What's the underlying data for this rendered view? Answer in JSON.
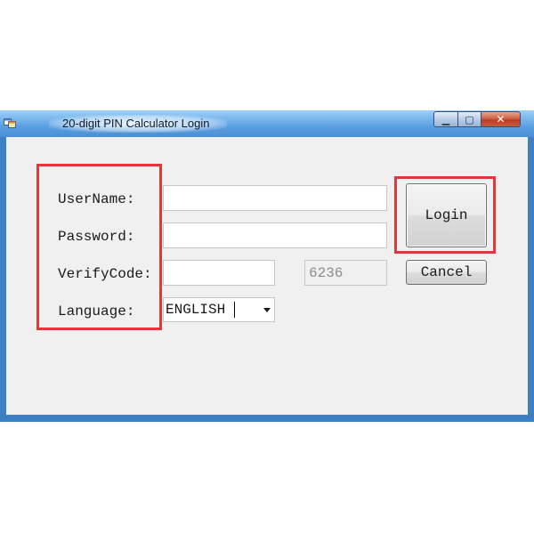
{
  "window": {
    "title": "20-digit PIN Calculator Login",
    "controls": {
      "minimize_glyph": "▁",
      "maximize_glyph": "▢",
      "close_glyph": "✕"
    }
  },
  "form": {
    "username": {
      "label": "UserName:",
      "value": ""
    },
    "password": {
      "label": "Password:",
      "value": ""
    },
    "verifycode": {
      "label": "VerifyCode:",
      "value": "",
      "code": "6236"
    },
    "language": {
      "label": "Language:",
      "selected": "ENGLISH"
    }
  },
  "buttons": {
    "login_label": "Login",
    "cancel_label": "Cancel"
  },
  "annotations": {
    "highlight_color": "#e0383a"
  },
  "icons": {
    "app": "app-window-icon",
    "dropdown": "dropdown-arrow-icon"
  }
}
